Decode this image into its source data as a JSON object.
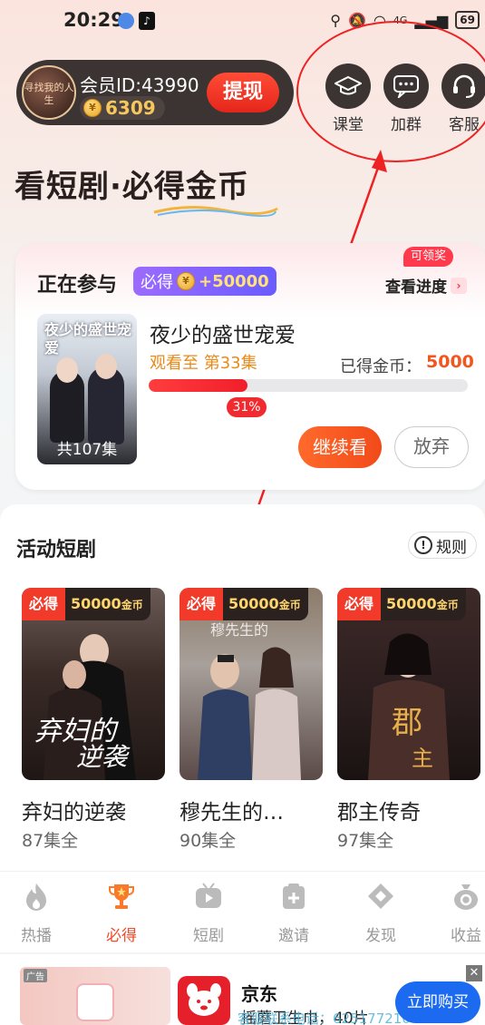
{
  "status_bar": {
    "time": "20:29",
    "network": "4G",
    "battery": "69"
  },
  "member": {
    "avatar_text": "寻找我的人生",
    "id_label": "会员ID:43990",
    "coins": "6309",
    "withdraw_label": "提现"
  },
  "tools": [
    {
      "label": "课堂",
      "icon": "graduation-cap-icon"
    },
    {
      "label": "加群",
      "icon": "chat-bubble-icon"
    },
    {
      "label": "客服",
      "icon": "headset-icon"
    }
  ],
  "headline": "看短剧·必得金币",
  "participating": {
    "title": "正在参与",
    "badge_prefix": "必得",
    "badge_amount": "+50000",
    "claim_tag": "可领奖",
    "progress_link": "查看进度",
    "cover_title": "夜少的盛世宠爱",
    "episodes_total": "共107集",
    "drama_name": "夜少的盛世宠爱",
    "watched": "观看至 第33集",
    "earned_label": "已得金币：",
    "earned_value": "5000",
    "progress_percent": 31,
    "progress_text": "31%",
    "continue_label": "继续看",
    "give_up_label": "放弃"
  },
  "activity": {
    "title": "活动短剧",
    "rules_label": "规则",
    "items": [
      {
        "tag_a": "必得",
        "tag_b": "50000",
        "tag_unit": "金币",
        "title": "弃妇的逆袭",
        "count": "87集全",
        "color": "#3a2b27"
      },
      {
        "tag_a": "必得",
        "tag_b": "50000",
        "tag_unit": "金币",
        "title": "穆先生的…",
        "count": "90集全",
        "color": "#5a4a48"
      },
      {
        "tag_a": "必得",
        "tag_b": "50000",
        "tag_unit": "金币",
        "title": "郡主传奇",
        "count": "97集全",
        "color": "#2a1d1d"
      }
    ]
  },
  "nav": [
    {
      "label": "热播",
      "icon": "flame-icon",
      "active": false
    },
    {
      "label": "必得",
      "icon": "trophy-icon",
      "active": true
    },
    {
      "label": "短剧",
      "icon": "tv-play-icon",
      "active": false
    },
    {
      "label": "邀请",
      "icon": "gift-add-icon",
      "active": false
    },
    {
      "label": "发现",
      "icon": "discover-icon",
      "active": false
    },
    {
      "label": "收益",
      "icon": "money-bag-icon",
      "active": false
    }
  ],
  "ad": {
    "badge": "广告",
    "brand": "京东",
    "desc": "摇蘑卫生巾，40片",
    "buy_label": "立即购买",
    "watermark": "客服联系电话：625177210"
  }
}
